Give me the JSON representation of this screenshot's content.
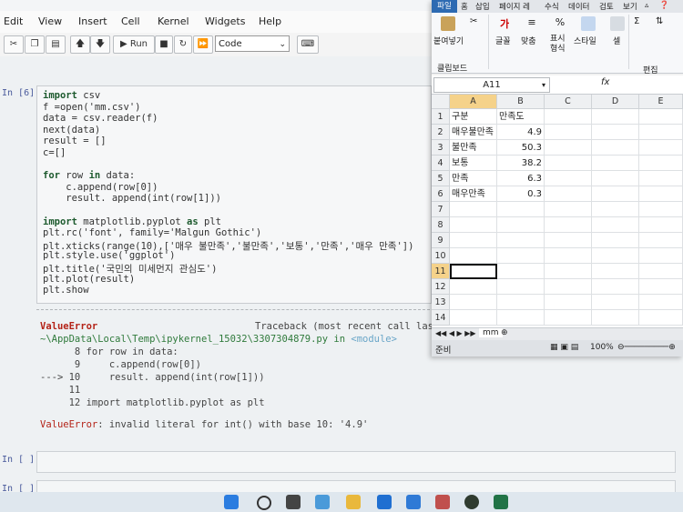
{
  "jupyter": {
    "menu": [
      "Edit",
      "View",
      "Insert",
      "Cell",
      "Kernel",
      "Widgets",
      "Help"
    ],
    "toolbar": {
      "run_label": "Run",
      "cell_type": "Code"
    },
    "cell6": {
      "prompt": "In [6]:",
      "lines": [
        "import csv",
        "f =open('mm.csv')",
        "data = csv.reader(f)",
        "next(data)",
        "result = []",
        "c=[]",
        "",
        "for row in data:",
        "    c.append(row[0])",
        "    result. append(int(row[1]))",
        "",
        "import matplotlib.pyplot as plt",
        "plt.rc('font', family='Malgun Gothic')",
        "plt.xticks(range(10),['매우 불만족','불만족','보통','만족','매우 만족'])",
        "plt.style.use('ggplot')",
        "plt.title('국민의 미세먼지 관심도')",
        "plt.plot(result)",
        "plt.show"
      ]
    },
    "error": {
      "name": "ValueError",
      "traceback_label": "Traceback (most recent call last)",
      "path": "~\\AppData\\Local\\Temp\\ipykernel_15032\\3307304879.py in ",
      "module": "<module>",
      "tb_lines": [
        "      8 for row in data:",
        "      9     c.append(row[0])",
        "---> 10     result. append(int(row[1]))",
        "     11",
        "     12 import matplotlib.pyplot as plt"
      ],
      "message_name": "ValueError",
      "message": ": invalid literal for int() with base 10: '4.9'"
    },
    "empty_prompt_1": "In [ ]:",
    "empty_prompt_2": "In [ ]:"
  },
  "excel": {
    "tabs": [
      "파일",
      "홈",
      "삽입",
      "페이지 레",
      "수식",
      "데이터",
      "검토",
      "보기"
    ],
    "ribbon": {
      "paste": "붙여넣기",
      "font": "글꼴",
      "align": "맞춤",
      "number": "표시\n형식",
      "style": "스타일",
      "cell": "셀",
      "clipboard": "클립보드",
      "edit": "편집"
    },
    "namebox": "A11",
    "fx": "fx",
    "columns": [
      "A",
      "B",
      "C",
      "D",
      "E"
    ],
    "rows": [
      "1",
      "2",
      "3",
      "4",
      "5",
      "6",
      "7",
      "8",
      "9",
      "10",
      "11",
      "12",
      "13",
      "14"
    ],
    "data": [
      {
        "a": "구분",
        "b": "만족도"
      },
      {
        "a": "매우불만족",
        "b": "4.9"
      },
      {
        "a": "불만족",
        "b": "50.3"
      },
      {
        "a": "보통",
        "b": "38.2"
      },
      {
        "a": "만족",
        "b": "6.3"
      },
      {
        "a": "매우만족",
        "b": "0.3"
      }
    ],
    "sheet_tab": "mm",
    "status": "준비",
    "zoom": "100%",
    "colors": {
      "file_tab": "#2d6ab2",
      "selection": "#f5d28a"
    }
  }
}
